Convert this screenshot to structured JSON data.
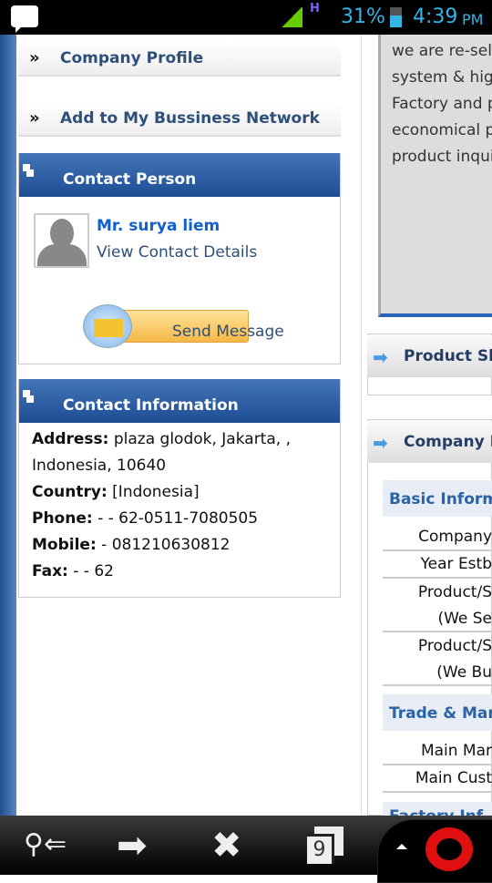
{
  "status_bar": {
    "battery": "31%",
    "time": "4:39",
    "ampm": "PM",
    "network": "H"
  },
  "left": {
    "nav": [
      {
        "label": "Company Profile"
      },
      {
        "label": "Add to My Bussiness Network"
      }
    ],
    "contact_person": {
      "title": "Contact Person",
      "name": "Mr. surya liem",
      "view_details": "View Contact Details",
      "send_message": "Send Message"
    },
    "contact_info": {
      "title": "Contact Information",
      "fields": [
        {
          "label": "Address:",
          "value": "plaza glodok, Jakarta, , Indonesia, 10640"
        },
        {
          "label": "Country:",
          "value": "[Indonesia]"
        },
        {
          "label": "Phone:",
          "value": "- - 62-0511-7080505"
        },
        {
          "label": "Mobile:",
          "value": "- 081210630812"
        },
        {
          "label": "Fax:",
          "value": "- - 62"
        }
      ]
    }
  },
  "right": {
    "about_lines": [
      "we are re-sel",
      "system & hig",
      "Factory and p",
      "economical p",
      "product inqui"
    ],
    "product_header": "Product Sh",
    "company_header": "Company P",
    "sections": [
      {
        "title": "Basic Informa",
        "rows": [
          [
            "Company"
          ],
          [
            "Year Estb"
          ],
          [
            "Product/S",
            "(We Se"
          ],
          [
            "Product/S",
            "(We Bu"
          ]
        ]
      },
      {
        "title": "Trade & Mark",
        "rows": [
          [
            "Main Mar"
          ],
          [
            "Main Cust"
          ]
        ]
      }
    ],
    "partial": "Factory Inf"
  },
  "toolbar": {
    "tabs_count": "9"
  }
}
